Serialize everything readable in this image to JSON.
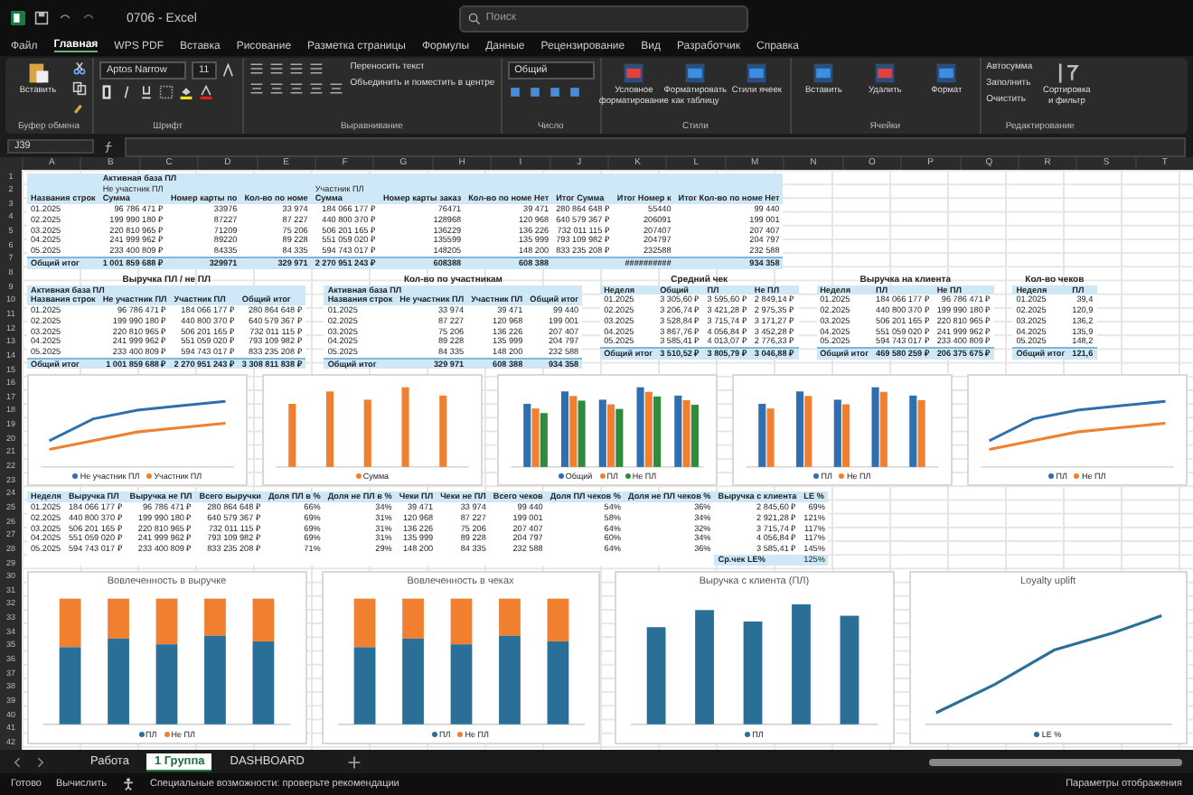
{
  "window": {
    "title": "0706 - Excel",
    "search": {
      "placeholder": "Поиск"
    }
  },
  "menu": [
    {
      "label": "Файл",
      "selected": false
    },
    {
      "label": "Главная",
      "selected": true
    },
    {
      "label": "WPS PDF",
      "selected": false
    },
    {
      "label": "Вставка",
      "selected": false
    },
    {
      "label": "Рисование",
      "selected": false
    },
    {
      "label": "Разметка страницы",
      "selected": false
    },
    {
      "label": "Формулы",
      "selected": false
    },
    {
      "label": "Данные",
      "selected": false
    },
    {
      "label": "Рецензирование",
      "selected": false
    },
    {
      "label": "Вид",
      "selected": false
    },
    {
      "label": "Разработчик",
      "selected": false
    },
    {
      "label": "Справка",
      "selected": false
    }
  ],
  "ribbon": [
    {
      "kind": "clipboard",
      "label": "Буфер обмена",
      "button": "Вставить"
    },
    {
      "kind": "font",
      "label": "Шрифт",
      "font": "Aptos Narrow",
      "size": "11"
    },
    {
      "kind": "align",
      "label": "Выравнивание",
      "items": [
        "Переносить текст",
        "Объединить и поместить в центре"
      ]
    },
    {
      "kind": "number",
      "label": "Число",
      "format": "Общий"
    },
    {
      "kind": "big",
      "label": "Стили",
      "buttons": [
        {
          "label": "Условное форматирование",
          "color": "#e04040"
        },
        {
          "label": "Форматировать как таблицу",
          "color": "#3a8ee6"
        },
        {
          "label": "Стили ячеек",
          "color": "#3a8ee6"
        }
      ]
    },
    {
      "kind": "big",
      "label": "Ячейки",
      "buttons": [
        {
          "label": "Вставить",
          "color": "#3a8ee6"
        },
        {
          "label": "Удалить",
          "color": "#e04040"
        },
        {
          "label": "Формат",
          "color": "#3a8ee6"
        }
      ]
    },
    {
      "kind": "edit",
      "label": "Редактирование",
      "items": [
        "Автосумма",
        "Заполнить",
        "Очистить"
      ],
      "button": "Сортировка и фильтр"
    }
  ],
  "formula_bar": {
    "cell": "J39"
  },
  "column_letters": [
    "A",
    "B",
    "C",
    "D",
    "E",
    "F",
    "G",
    "H",
    "I",
    "J",
    "K",
    "L",
    "M",
    "N",
    "O",
    "P",
    "Q",
    "R",
    "S",
    "T"
  ],
  "row_numbers": [
    "1",
    "2",
    "3",
    "4",
    "5",
    "6",
    "7",
    "8",
    "9",
    "10",
    "11",
    "12",
    "13",
    "14",
    "15",
    "16",
    "17",
    "18",
    "19",
    "20",
    "21",
    "22",
    "23",
    "24",
    "25",
    "26",
    "27",
    "28",
    "29",
    "30",
    "31",
    "32",
    "33",
    "34",
    "35",
    "36",
    "37",
    "38",
    "39",
    "40",
    "41",
    "42"
  ],
  "pivot": {
    "filter": "Активная база ПЛ",
    "groups": [
      "Не участник ПЛ",
      "Участник ПЛ"
    ],
    "columns": [
      "Названия строк",
      "Сумма",
      "Номер карты по",
      "Кол-во по номе",
      "Сумма",
      "Номер карты заказ",
      "Кол-во по номе Нет",
      "Итог Сумма",
      "Итог Номер к",
      "Итог Кол-во по номе Нет"
    ],
    "rows": [
      [
        "01.2025",
        "96 786 471 ₽",
        "33976",
        "33 974",
        "184 066 177 ₽",
        "76471",
        "39 471",
        "280 864 648 ₽",
        "55440",
        "99 440"
      ],
      [
        "02.2025",
        "199 990 180 ₽",
        "87227",
        "87 227",
        "440 800 370 ₽",
        "128968",
        "120 968",
        "640 579 367 ₽",
        "206091",
        "199 001"
      ],
      [
        "03.2025",
        "220 810 965 ₽",
        "71209",
        "75 206",
        "506 201 165 ₽",
        "136229",
        "136 226",
        "732 011 115 ₽",
        "207407",
        "207 407"
      ],
      [
        "04.2025",
        "241 999 962 ₽",
        "89220",
        "89 228",
        "551 059 020 ₽",
        "135599",
        "135 999",
        "793 109 982 ₽",
        "204797",
        "204 797"
      ],
      [
        "05.2025",
        "233 400 809 ₽",
        "84335",
        "84 335",
        "594 743 017 ₽",
        "148205",
        "148 200",
        "833 235 208 ₽",
        "232588",
        "232 588"
      ]
    ],
    "total": [
      "Общий итог",
      "1 001 859 688 ₽",
      "329971",
      "329 971",
      "2 270 951 243 ₽",
      "608388",
      "608 388",
      "##########",
      "934 358"
    ]
  },
  "tables": [
    {
      "title": "Выручка ПЛ / не ПЛ",
      "filter": "Активная база ПЛ",
      "columns": [
        "Названия строк",
        "Не участник ПЛ",
        "Участник ПЛ",
        "Общий итог"
      ],
      "rows": [
        [
          "01.2025",
          "96 786 471 ₽",
          "184 066 177 ₽",
          "280 864 648 ₽"
        ],
        [
          "02.2025",
          "199 990 180 ₽",
          "440 800 370 ₽",
          "640 579 367 ₽"
        ],
        [
          "03.2025",
          "220 810 965 ₽",
          "506 201 165 ₽",
          "732 011 115 ₽"
        ],
        [
          "04.2025",
          "241 999 962 ₽",
          "551 059 020 ₽",
          "793 109 982 ₽"
        ],
        [
          "05.2025",
          "233 400 809 ₽",
          "594 743 017 ₽",
          "833 235 208 ₽"
        ]
      ],
      "total": [
        "Общий итог",
        "1 001 859 688 ₽",
        "2 270 951 243 ₽",
        "3 308 811 838 ₽"
      ]
    },
    {
      "title": "Кол-во по участникам",
      "filter": "Активная база ПЛ",
      "columns": [
        "Названия строк",
        "Не участник ПЛ",
        "Участник ПЛ",
        "Общий итог"
      ],
      "rows": [
        [
          "01.2025",
          "33 974",
          "39 471",
          "99 440"
        ],
        [
          "02.2025",
          "87 227",
          "120 968",
          "199 001"
        ],
        [
          "03.2025",
          "75 206",
          "136 226",
          "207 407"
        ],
        [
          "04.2025",
          "89 228",
          "135 999",
          "204 797"
        ],
        [
          "05.2025",
          "84 335",
          "148 200",
          "232 588"
        ]
      ],
      "total": [
        "Общий итог",
        "329 971",
        "608 388",
        "934 358"
      ]
    },
    {
      "title": "Средний чек",
      "columns": [
        "Неделя",
        "Общий",
        "ПЛ",
        "Не ПЛ"
      ],
      "rows": [
        [
          "01.2025",
          "3 305,60 ₽",
          "3 595,60 ₽",
          "2 849,14 ₽"
        ],
        [
          "02.2025",
          "3 206,74 ₽",
          "3 421,28 ₽",
          "2 975,35 ₽"
        ],
        [
          "03.2025",
          "3 528,84 ₽",
          "3 715,74 ₽",
          "3 171,27 ₽"
        ],
        [
          "04.2025",
          "3 867,76 ₽",
          "4 056,84 ₽",
          "3 452,28 ₽"
        ],
        [
          "05.2025",
          "3 585,41 ₽",
          "4 013,07 ₽",
          "2 776,33 ₽"
        ]
      ],
      "total": [
        "Общий итог",
        "3 510,52 ₽",
        "3 805,79 ₽",
        "3 046,88 ₽"
      ]
    },
    {
      "title": "Выручка на клиента",
      "columns": [
        "Неделя",
        "ПЛ",
        "Не ПЛ"
      ],
      "rows": [
        [
          "01.2025",
          "184 066 177 ₽",
          "96 786 471 ₽"
        ],
        [
          "02.2025",
          "440 800 370 ₽",
          "199 990 180 ₽"
        ],
        [
          "03.2025",
          "506 201 165 ₽",
          "220 810 965 ₽"
        ],
        [
          "04.2025",
          "551 059 020 ₽",
          "241 999 962 ₽"
        ],
        [
          "05.2025",
          "594 743 017 ₽",
          "233 400 809 ₽"
        ]
      ],
      "total": [
        "Общий итог",
        "469 580 259 ₽",
        "206 375 675 ₽"
      ]
    },
    {
      "title": "Кол-во чеков",
      "columns": [
        "Неделя",
        "ПЛ"
      ],
      "rows": [
        [
          "01.2025",
          "39,4"
        ],
        [
          "02.2025",
          "120,9"
        ],
        [
          "03.2025",
          "136,2"
        ],
        [
          "04.2025",
          "135,9"
        ],
        [
          "05.2025",
          "148,2"
        ]
      ],
      "total": [
        "Общий итог",
        "121,6"
      ]
    }
  ],
  "charts_top": [
    {
      "kind": "line",
      "legend": [
        {
          "name": "Не участник ПЛ",
          "color": "#2f6fb0"
        },
        {
          "name": "Участник ПЛ",
          "color": "#f08030"
        }
      ]
    },
    {
      "kind": "bars",
      "legend": [
        {
          "name": "Сумма",
          "color": "#f08030"
        }
      ]
    },
    {
      "kind": "grouped",
      "legend": [
        {
          "name": "Общий",
          "color": "#2f6fb0"
        },
        {
          "name": "ПЛ",
          "color": "#f08030"
        },
        {
          "name": "Не ПЛ",
          "color": "#2e8b3e"
        }
      ]
    },
    {
      "kind": "pairs",
      "legend": [
        {
          "name": "ПЛ",
          "color": "#2f6fb0"
        },
        {
          "name": "Не ПЛ",
          "color": "#f08030"
        }
      ]
    },
    {
      "kind": "line",
      "legend": [
        {
          "name": "ПЛ",
          "color": "#2f6fb0"
        },
        {
          "name": "Не ПЛ",
          "color": "#f08030"
        }
      ]
    }
  ],
  "summary": {
    "columns": [
      "Неделя",
      "Выручка ПЛ",
      "Выручка не ПЛ",
      "Всего выручки",
      "Доля ПЛ в %",
      "Доля не ПЛ в %",
      "Чеки ПЛ",
      "Чеки не ПЛ",
      "Всего чеков",
      "Доля ПЛ чеков %",
      "Доля не ПЛ чеков %",
      "Выручка с клиента",
      "LE %"
    ],
    "rows": [
      [
        "01.2025",
        "184 066 177 ₽",
        "96 786 471 ₽",
        "280 864 648 ₽",
        "66%",
        "34%",
        "39 471",
        "33 974",
        "99 440",
        "54%",
        "36%",
        "2 845,60 ₽",
        "69%"
      ],
      [
        "02.2025",
        "440 800 370 ₽",
        "199 990 180 ₽",
        "640 579 367 ₽",
        "69%",
        "31%",
        "120 968",
        "87 227",
        "199 001",
        "58%",
        "34%",
        "2 921,28 ₽",
        "121%"
      ],
      [
        "03.2025",
        "506 201 165 ₽",
        "220 810 965 ₽",
        "732 011 115 ₽",
        "69%",
        "31%",
        "136 226",
        "75 206",
        "207 407",
        "64%",
        "32%",
        "3 715,74 ₽",
        "117%"
      ],
      [
        "04.2025",
        "551 059 020 ₽",
        "241 999 962 ₽",
        "793 109 982 ₽",
        "69%",
        "31%",
        "135 999",
        "89 228",
        "204 797",
        "60%",
        "34%",
        "4 056,84 ₽",
        "117%"
      ],
      [
        "05.2025",
        "594 743 017 ₽",
        "233 400 809 ₽",
        "833 235 208 ₽",
        "71%",
        "29%",
        "148 200",
        "84 335",
        "232 588",
        "64%",
        "36%",
        "3 585,41 ₽",
        "145%"
      ]
    ],
    "extra": [
      "Ср.чек LE%",
      "125%"
    ]
  },
  "charts_bottom": [
    {
      "kind": "stacked",
      "title": "Вовлеченность в выручке",
      "legend": [
        {
          "name": "ПЛ",
          "color": "#2a6f97"
        },
        {
          "name": "Не ПЛ",
          "color": "#f08030"
        }
      ]
    },
    {
      "kind": "stacked",
      "title": "Вовлеченность в чеках",
      "legend": [
        {
          "name": "ПЛ",
          "color": "#2a6f97"
        },
        {
          "name": "Не ПЛ",
          "color": "#f08030"
        }
      ]
    },
    {
      "kind": "bars",
      "title": "Выручка с клиента (ПЛ)",
      "legend": [
        {
          "name": "ПЛ",
          "color": "#2a6f97"
        }
      ]
    },
    {
      "kind": "line",
      "title": "Loyalty uplift",
      "legend": [
        {
          "name": "LE %",
          "color": "#2a6f97"
        }
      ]
    }
  ],
  "sheet_tabs": [
    {
      "label": "Работа",
      "selected": false
    },
    {
      "label": "1 Группа",
      "selected": true
    },
    {
      "label": "DASHBOARD",
      "selected": false
    }
  ],
  "status_bar": {
    "ready": "Готово",
    "calc": "Вычислить",
    "accessibility": "Специальные возможности: проверьте рекомендации",
    "display": "Параметры отображения"
  }
}
